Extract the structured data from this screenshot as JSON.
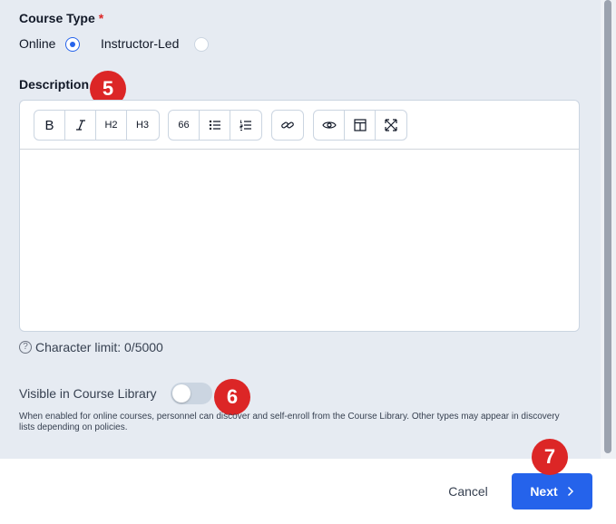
{
  "course_type": {
    "label": "Course Type",
    "required_mark": "*",
    "options": [
      {
        "label": "Online",
        "selected": true
      },
      {
        "label": "Instructor-Led",
        "selected": false
      }
    ]
  },
  "description": {
    "label": "Description",
    "toolbar": {
      "groups": [
        [
          "bold-icon",
          "italic-icon",
          "heading-2",
          "heading-3"
        ],
        [
          "quote-icon",
          "bulleted-list-icon",
          "numbered-list-icon"
        ],
        [
          "link-icon"
        ],
        [
          "eye-icon",
          "side-by-side-icon",
          "fullscreen-icon"
        ]
      ],
      "bold": "B",
      "h2": "H2",
      "h3": "H3",
      "quote": "66"
    },
    "value": "",
    "char_limit": "Character limit: 0/5000"
  },
  "visibility": {
    "label": "Visible in Course Library",
    "enabled": false,
    "help": "When enabled for online courses, personnel can discover and self-enroll from the Course Library. Other types may appear in discovery lists depending on policies."
  },
  "annotations": [
    "5",
    "6",
    "7"
  ],
  "footer": {
    "cancel_label": "Cancel",
    "next_label": "Next"
  },
  "colors": {
    "primary": "#2563eb",
    "badge": "#dc2626",
    "panel": "#e6ebf2"
  }
}
